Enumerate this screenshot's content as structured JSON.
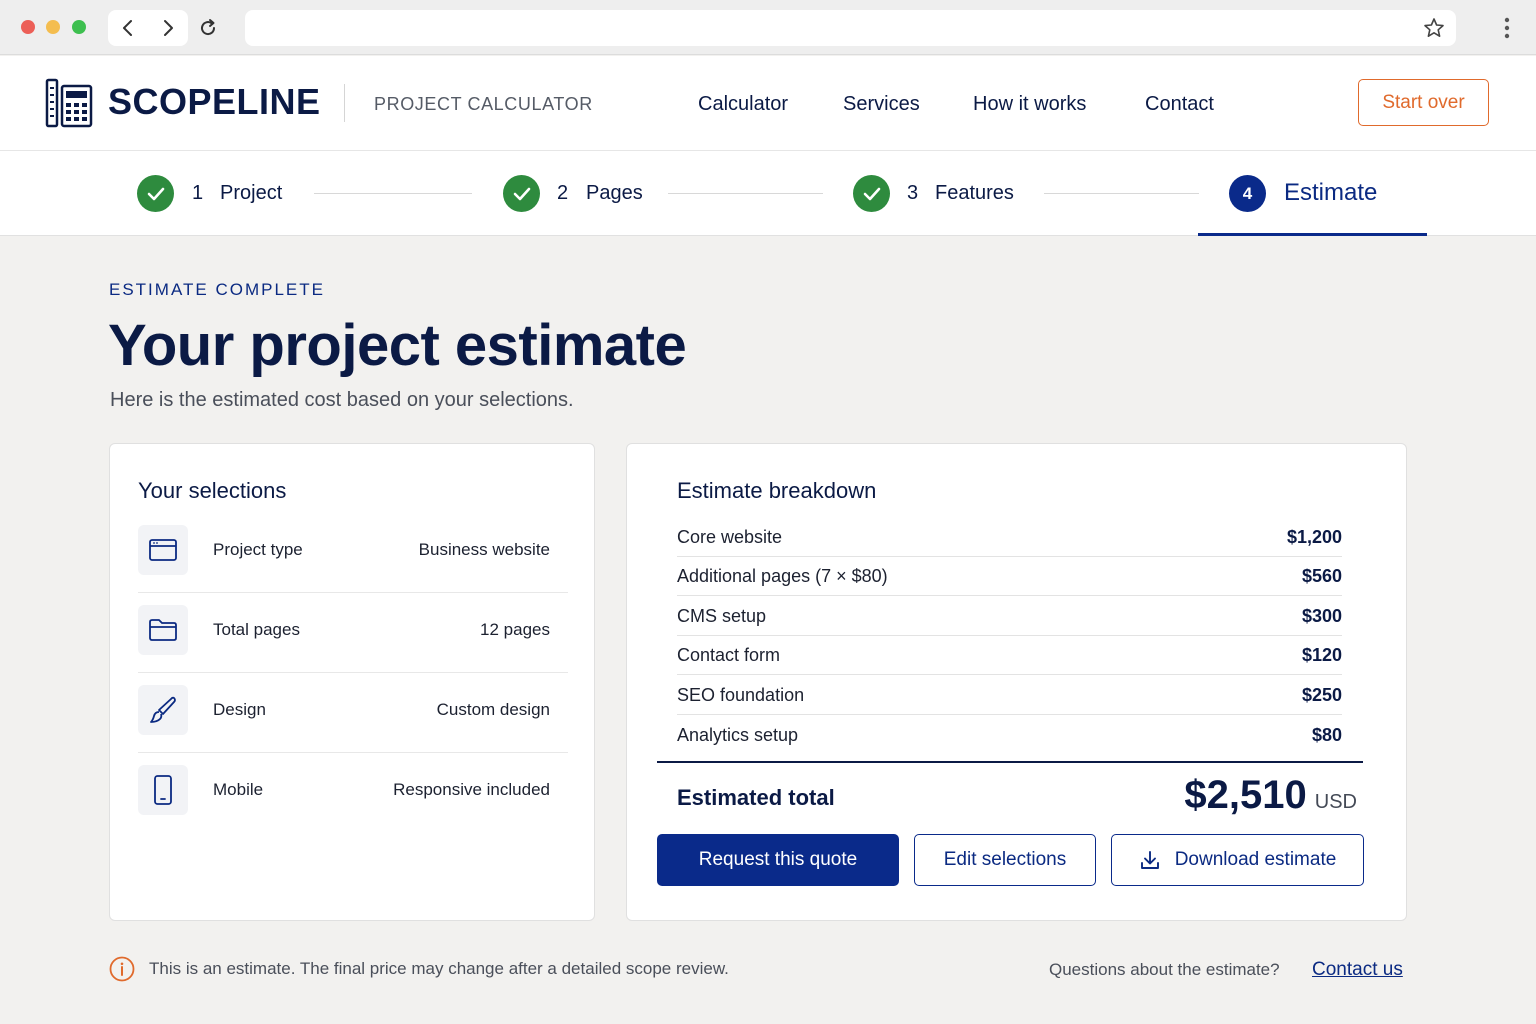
{
  "header": {
    "brand": "SCOPELINE",
    "subtitle": "PROJECT CALCULATOR",
    "nav": [
      "Calculator",
      "Services",
      "How it works",
      "Contact"
    ],
    "start_over": "Start over"
  },
  "steps": [
    {
      "num": "1",
      "label": "Project",
      "status": "complete"
    },
    {
      "num": "2",
      "label": "Pages",
      "status": "complete"
    },
    {
      "num": "3",
      "label": "Features",
      "status": "complete"
    },
    {
      "num": "4",
      "label": "Estimate",
      "status": "active"
    }
  ],
  "hero": {
    "eyebrow": "ESTIMATE COMPLETE",
    "title": "Your project estimate",
    "subtitle": "Here is the estimated cost based on your selections."
  },
  "selections": {
    "title": "Your selections",
    "items": [
      {
        "icon": "browser-window-icon",
        "label": "Project type",
        "value": "Business website"
      },
      {
        "icon": "folder-icon",
        "label": "Total pages",
        "value": "12 pages"
      },
      {
        "icon": "paintbrush-icon",
        "label": "Design",
        "value": "Custom design"
      },
      {
        "icon": "mobile-phone-icon",
        "label": "Mobile",
        "value": "Responsive included"
      }
    ]
  },
  "breakdown": {
    "title": "Estimate breakdown",
    "items": [
      {
        "label": "Core website",
        "value": "$1,200"
      },
      {
        "label": "Additional pages (7 × $80)",
        "value": "$560"
      },
      {
        "label": "CMS setup",
        "value": "$300"
      },
      {
        "label": "Contact form",
        "value": "$120"
      },
      {
        "label": "SEO foundation",
        "value": "$250"
      },
      {
        "label": "Analytics setup",
        "value": "$80"
      }
    ],
    "total_label": "Estimated total",
    "total_value": "$2,510",
    "currency": "USD",
    "buttons": {
      "request": "Request this quote",
      "edit": "Edit selections",
      "download": "Download estimate"
    }
  },
  "footer": {
    "disclaimer": "This is an estimate. The final price may change after a detailed scope review.",
    "questions": "Questions about the estimate?",
    "contact": "Contact us"
  },
  "colors": {
    "navy": "#0b1a45",
    "primary": "#0a2a8a",
    "accent_orange": "#e06a2c",
    "success_green": "#2e8b3e",
    "background": "#f2f1ef"
  }
}
